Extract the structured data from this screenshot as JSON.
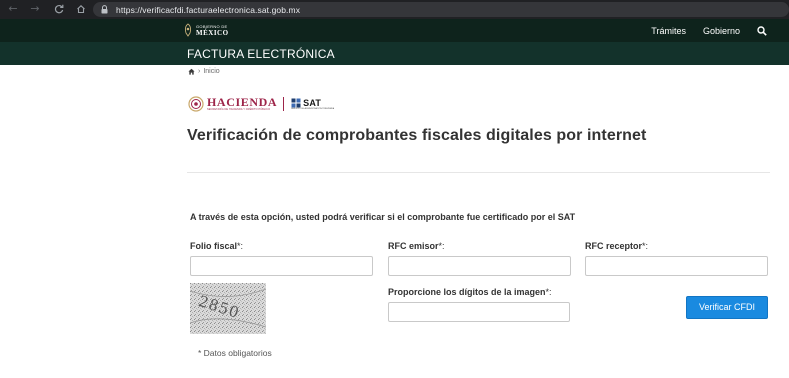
{
  "browser": {
    "url": "https://verificacfdi.facturaelectronica.sat.gob.mx",
    "back_icon": "arrow-left-icon",
    "forward_icon": "arrow-right-icon",
    "reload_icon": "reload-icon",
    "home_icon": "home-icon"
  },
  "gov_header": {
    "logo_small": "GOBIERNO DE",
    "logo_big": "MÉXICO",
    "nav": [
      "Trámites",
      "Gobierno"
    ],
    "search_icon": "search-icon"
  },
  "section": {
    "title": "FACTURA ELECTRÓNICA"
  },
  "breadcrumb": {
    "separator": "›",
    "current": "Inicio"
  },
  "logos": {
    "hacienda": "HACIENDA",
    "hacienda_sub": "SECRETARÍA DE HACIENDA Y CRÉDITO PÚBLICO",
    "sat": "SAT",
    "sat_sub": "SERVICIO DE ADMINISTRACIÓN TRIBUTARIA"
  },
  "page": {
    "title": "Verificación de comprobantes fiscales digitales por internet"
  },
  "form": {
    "instructions": "A través de esta opción, usted podrá verificar si el comprobante fue certificado por el SAT",
    "folio_label": "Folio fiscal",
    "rfc_emisor_label": "RFC emisor",
    "rfc_receptor_label": "RFC receptor",
    "captcha_label": "Proporcione los dígitos de la imagen",
    "required_mark": "*:",
    "captcha_text": "2850",
    "folio_value": "",
    "rfc_emisor_value": "",
    "rfc_receptor_value": "",
    "captcha_value": "",
    "submit_label": "Verificar CFDI",
    "required_note": "* Datos obligatorios"
  },
  "colors": {
    "gov_dark": "#0e231c",
    "band_green": "#13322b",
    "hacienda": "#9d2449",
    "button_blue": "#1a8ae0"
  }
}
